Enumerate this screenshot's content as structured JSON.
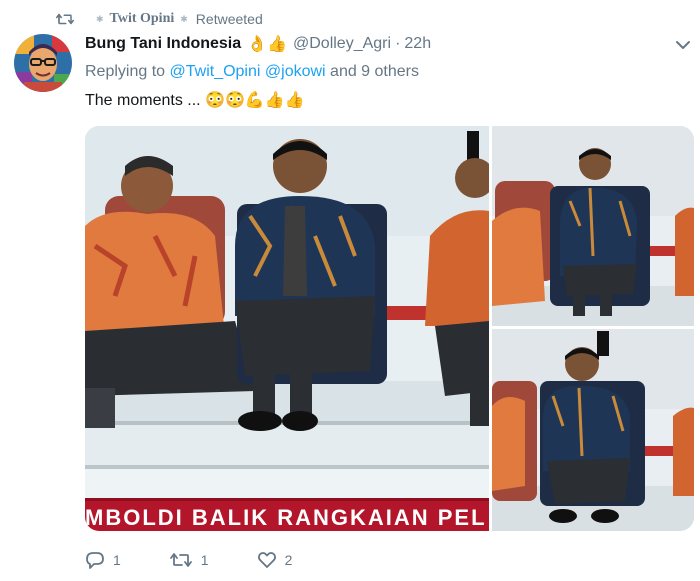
{
  "retweet_bar": {
    "name": "Twit Opini",
    "label": "Retweeted"
  },
  "tweet": {
    "author": "Bung Tani Indonesia",
    "author_emoji": "👌👍",
    "handle": "@Dolley_Agri",
    "separator": "·",
    "time": "22h",
    "reply_prefix": "Replying to ",
    "reply_mention_1": "@Twit_Opini",
    "reply_mention_2": "@jokowi",
    "reply_suffix": " and 9 others",
    "text": "The moments ... 😳😳💪👍👍"
  },
  "media": {
    "banner_text": "MBOLDI BALIK RANGKAIAN PEL"
  },
  "actions": {
    "reply_count": "1",
    "retweet_count": "1",
    "like_count": "2"
  },
  "colors": {
    "accent": "#1da1f2",
    "secondary_text": "#657786",
    "banner_red": "#b3152a"
  }
}
